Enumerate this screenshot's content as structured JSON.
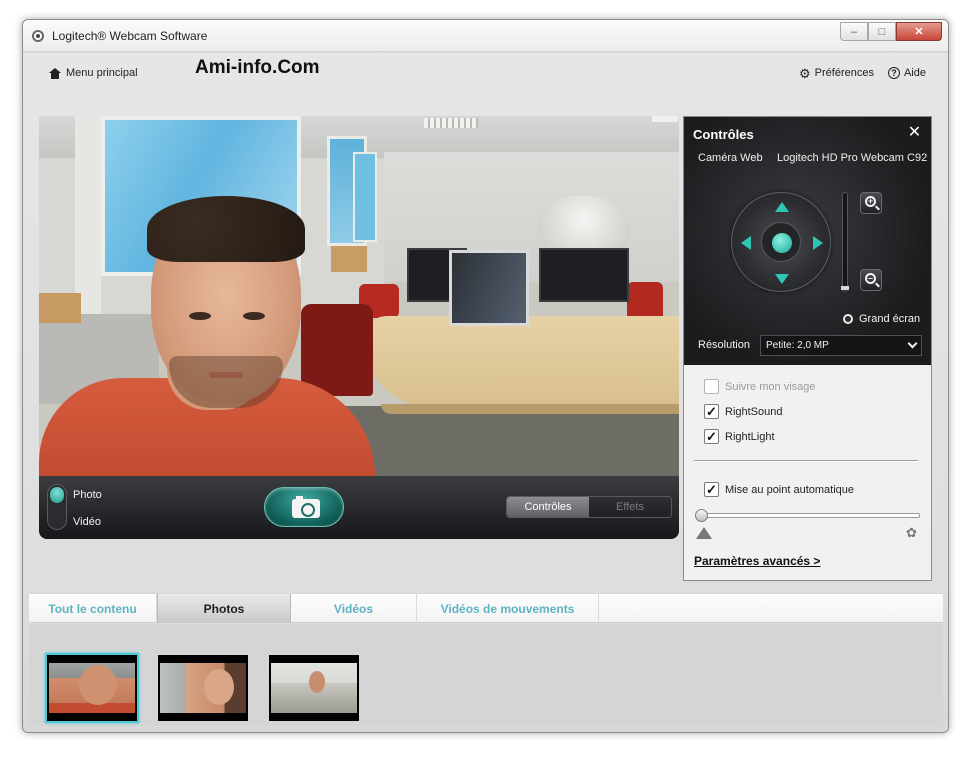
{
  "window": {
    "title": "Logitech® Webcam Software",
    "minimize": "–",
    "maximize": "□",
    "close": "✕"
  },
  "header": {
    "menu_principal": "Menu principal",
    "watermark": "Ami-info.Com",
    "preferences": "Préférences",
    "help": "Aide"
  },
  "camera_bar": {
    "mode_photo": "Photo",
    "mode_video": "Vidéo",
    "tab_controls": "Contrôles",
    "tab_effects": "Effets"
  },
  "controls_panel": {
    "title": "Contrôles",
    "camera_label": "Caméra Web",
    "camera_name": "Logitech HD Pro Webcam C92",
    "fullscreen": "Grand écran",
    "resolution_label": "Résolution",
    "resolution_value": "Petite: 2,0 MP",
    "follow_face": "Suivre mon visage",
    "right_sound": "RightSound",
    "right_light": "RightLight",
    "autofocus": "Mise au point automatique",
    "advanced": "Paramètres avancés >",
    "follow_face_checked": false,
    "right_sound_checked": true,
    "right_light_checked": true,
    "autofocus_checked": true,
    "focus_level": 0.0,
    "zoom_level": 0.0
  },
  "tabs": [
    {
      "label": "Tout le contenu"
    },
    {
      "label": "Photos"
    },
    {
      "label": "Vidéos"
    },
    {
      "label": "Vidéos de mouvements"
    }
  ],
  "gallery": {
    "selected_index": 0
  },
  "colors": {
    "accent": "#2fc5b4",
    "tab_text": "#5fb3c2",
    "selected_border": "#4ec8d4"
  }
}
